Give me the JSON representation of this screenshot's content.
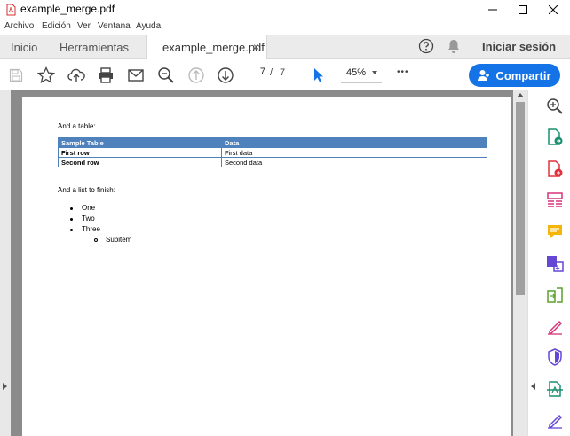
{
  "window": {
    "title": "example_merge.pdf"
  },
  "menu": [
    "Archivo",
    "Edición",
    "Ver",
    "Ventana",
    "Ayuda"
  ],
  "tabs": {
    "home": "Inicio",
    "tools": "Herramientas",
    "document": "example_merge.pdf",
    "close_glyph": "×"
  },
  "header": {
    "signin": "Iniciar sesión"
  },
  "toolbar": {
    "page_current": "7",
    "page_sep": "/",
    "page_total": "7",
    "zoom": "45%",
    "share": "Compartir",
    "more_glyph": "•••"
  },
  "document": {
    "intro_table": "And a table:",
    "table": {
      "headers": [
        "Sample Table",
        "Data"
      ],
      "rows": [
        [
          "First row",
          "First data"
        ],
        [
          "Second row",
          "Second data"
        ]
      ]
    },
    "intro_list": "And a list to finish:",
    "list": [
      "One",
      "Two",
      "Three"
    ],
    "subitem": "Subitem"
  },
  "colors": {
    "accent": "#1473e6",
    "table_header": "#4f81bd"
  }
}
